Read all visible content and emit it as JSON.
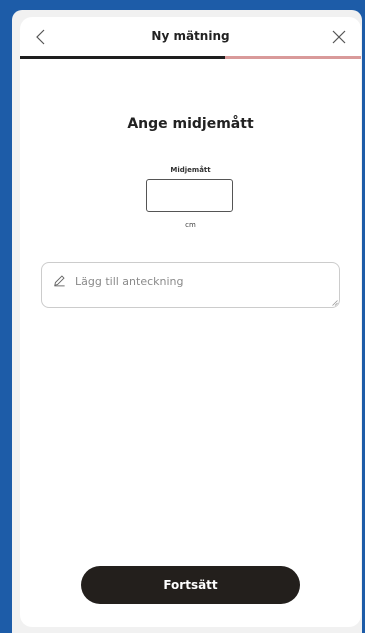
{
  "header": {
    "title": "Ny mätning",
    "back_icon": "chevron-left-icon",
    "close_icon": "close-icon"
  },
  "progress": {
    "value": 0.6,
    "fill_color": "#1e1e1e",
    "track_color": "#d99a9a"
  },
  "main": {
    "title": "Ange midjemått",
    "field_label": "Midjemått",
    "field_value": "",
    "unit": "cm"
  },
  "note": {
    "icon": "pencil-icon",
    "placeholder": "Lägg till anteckning"
  },
  "footer": {
    "continue_label": "Fortsätt",
    "button_color": "#231f1c"
  },
  "colors": {
    "background": "#1d5ca8",
    "card": "#ffffff"
  }
}
